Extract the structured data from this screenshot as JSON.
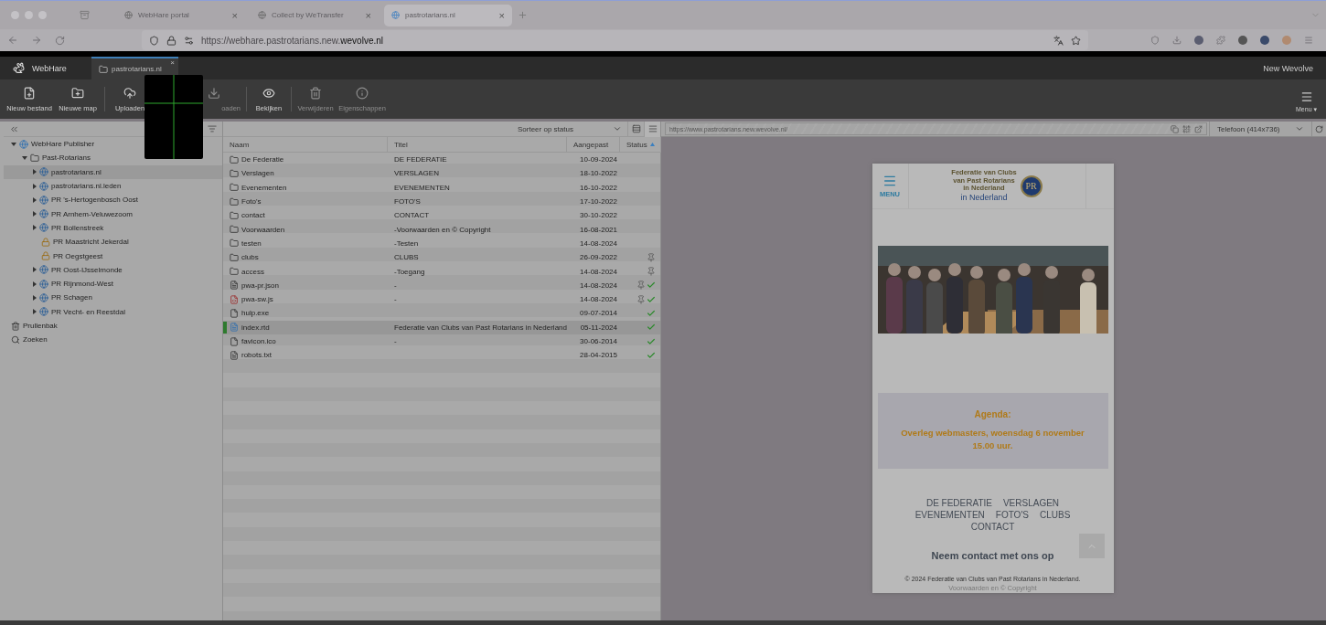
{
  "browser": {
    "tabs": [
      {
        "title": "WebHare portal",
        "close": "×",
        "selected": false
      },
      {
        "title": "Collect by WeTransfer",
        "close": "×",
        "selected": false
      },
      {
        "title": "pastrotarians.nl",
        "close": "×",
        "selected": true
      }
    ],
    "url": "https://webhare.pastrotarians.new.**wevolve.nl**"
  },
  "app": {
    "brand": "WebHare",
    "tabs": [
      {
        "label": "pastrotarians.nl",
        "close": "×",
        "selected": true
      }
    ],
    "account": "New Wevolve",
    "toolbar": [
      {
        "label": "Nieuw bestand",
        "kind": "new-file",
        "disabled": false
      },
      {
        "label": "Nieuwe map",
        "kind": "new-folder",
        "disabled": false
      },
      {
        "label": "Uploaden",
        "kind": "upload",
        "disabled": false
      },
      {
        "label": "oaden",
        "kind": "download",
        "disabled": true
      },
      {
        "label": "Bekijken",
        "kind": "view",
        "disabled": false
      },
      {
        "label": "Verwijderen",
        "kind": "delete",
        "disabled": true
      },
      {
        "label": "Eigenschappen",
        "kind": "properties",
        "disabled": true
      }
    ],
    "menu": {
      "label": "Menu",
      "caret": "▾"
    }
  },
  "tree": {
    "items": [
      {
        "label": "WebHare Publisher",
        "kind": "publisher",
        "expanded": true,
        "selected": false,
        "children": [
          {
            "label": "Past-Rotarians",
            "kind": "folder",
            "expanded": true,
            "selected": false,
            "children": [
              {
                "label": "pastrotarians.nl",
                "kind": "site",
                "expanded": false,
                "selected": true
              },
              {
                "label": "pastrotarians.nl.leden",
                "kind": "site",
                "expanded": false,
                "selected": false
              },
              {
                "label": "PR 's-Hertogenbosch Oost",
                "kind": "site",
                "expanded": false,
                "selected": false
              },
              {
                "label": "PR Arnhem-Veluwezoom",
                "kind": "site",
                "expanded": false,
                "selected": false
              },
              {
                "label": "PR Bollenstreek",
                "kind": "site",
                "expanded": false,
                "selected": false
              },
              {
                "label": "PR Maastricht Jekerdal",
                "kind": "locked-site",
                "selected": false
              },
              {
                "label": "PR Oegstgeest",
                "kind": "locked-site",
                "selected": false
              },
              {
                "label": "PR Oost-IJsselmonde",
                "kind": "site",
                "expanded": false,
                "selected": false
              },
              {
                "label": "PR Rijnmond-West",
                "kind": "site",
                "expanded": false,
                "selected": false
              },
              {
                "label": "PR Schagen",
                "kind": "site",
                "expanded": false,
                "selected": false
              },
              {
                "label": "PR Vecht- en Reestdal",
                "kind": "site",
                "expanded": false,
                "selected": false
              }
            ]
          }
        ]
      },
      {
        "label": "Prullenbak",
        "kind": "trash",
        "selected": false
      },
      {
        "label": "Zoeken",
        "kind": "search",
        "selected": false
      }
    ]
  },
  "list": {
    "sort": "Sorteer op status",
    "columns": [
      {
        "label": "Naam",
        "sorted": false
      },
      {
        "label": "Titel",
        "sorted": false
      },
      {
        "label": "Aangepast",
        "sorted": false
      },
      {
        "label": "Status",
        "sorted": true
      }
    ],
    "rows": [
      {
        "name": "De Federatie",
        "title": "DE FEDERATIE",
        "modified": "10-09-2024",
        "kind": "folder",
        "pinned": false,
        "published": false,
        "selected": false
      },
      {
        "name": "Verslagen",
        "title": "VERSLAGEN",
        "modified": "18-10-2022",
        "kind": "folder",
        "pinned": false,
        "published": false,
        "selected": false
      },
      {
        "name": "Evenementen",
        "title": "EVENEMENTEN",
        "modified": "16-10-2022",
        "kind": "folder",
        "pinned": false,
        "published": false,
        "selected": false
      },
      {
        "name": "Foto's",
        "title": "FOTO'S",
        "modified": "17-10-2022",
        "kind": "folder",
        "pinned": false,
        "published": false,
        "selected": false
      },
      {
        "name": "contact",
        "title": "CONTACT",
        "modified": "30-10-2022",
        "kind": "folder",
        "pinned": false,
        "published": false,
        "selected": false
      },
      {
        "name": "Voorwaarden",
        "title": "-Voorwaarden en © Copyright",
        "modified": "16-08-2021",
        "kind": "folder",
        "pinned": false,
        "published": false,
        "selected": false
      },
      {
        "name": "testen",
        "title": "-Testen",
        "modified": "14-08-2024",
        "kind": "folder",
        "pinned": false,
        "published": false,
        "selected": false
      },
      {
        "name": "clubs",
        "title": "CLUBS",
        "modified": "26-09-2022",
        "kind": "folder",
        "pinned": true,
        "published": false,
        "selected": false
      },
      {
        "name": "access",
        "title": "-Toegang",
        "modified": "14-08-2024",
        "kind": "folder",
        "pinned": true,
        "published": false,
        "selected": false
      },
      {
        "name": "pwa-pr.json",
        "title": "-",
        "modified": "14-08-2024",
        "kind": "text",
        "pinned": true,
        "published": true,
        "selected": false
      },
      {
        "name": "pwa-sw.js",
        "title": "-",
        "modified": "14-08-2024",
        "kind": "script",
        "pinned": true,
        "published": true,
        "selected": false
      },
      {
        "name": "hulp.exe",
        "modified": "09-07-2014",
        "kind": "unknown",
        "pinned": false,
        "published": true,
        "selected": false
      },
      {
        "name": "index.rtd",
        "title": "Federatie van Clubs van Past Rotarians in Nederland",
        "modified": "05-11-2024",
        "kind": "page",
        "pinned": false,
        "published": true,
        "selected": true
      },
      {
        "name": "favicon.ico",
        "title": "-",
        "modified": "30-06-2014",
        "kind": "unknown",
        "pinned": false,
        "published": true,
        "selected": false
      },
      {
        "name": "robots.txt",
        "modified": "28-04-2015",
        "kind": "text",
        "pinned": false,
        "published": true,
        "selected": false
      }
    ]
  },
  "preview": {
    "url": "https://www.pastrotarians.new.wevolve.nl/",
    "device": "Telefoon (414x736)",
    "site": {
      "menu": "MENU",
      "logo_small": [
        "Federatie van Clubs",
        "van Past Rotarians",
        "in Nederland"
      ],
      "logo_large": "in Nederland",
      "logo_mark": "PR",
      "agenda_title": "Agenda:",
      "agenda_text": "Overleg webmasters, woensdag 6 november 15.00 uur.",
      "nav": [
        "DE FEDERATIE",
        "VERSLAGEN",
        "EVENEMENTEN",
        "FOTO'S",
        "CLUBS",
        "CONTACT"
      ],
      "contact": "Neem contact met ons op",
      "copyright": "© 2024 Federatie van Clubs van Past Rotarians in Nederland.",
      "footer_link": "Voorwaarden en © Copyright"
    }
  }
}
